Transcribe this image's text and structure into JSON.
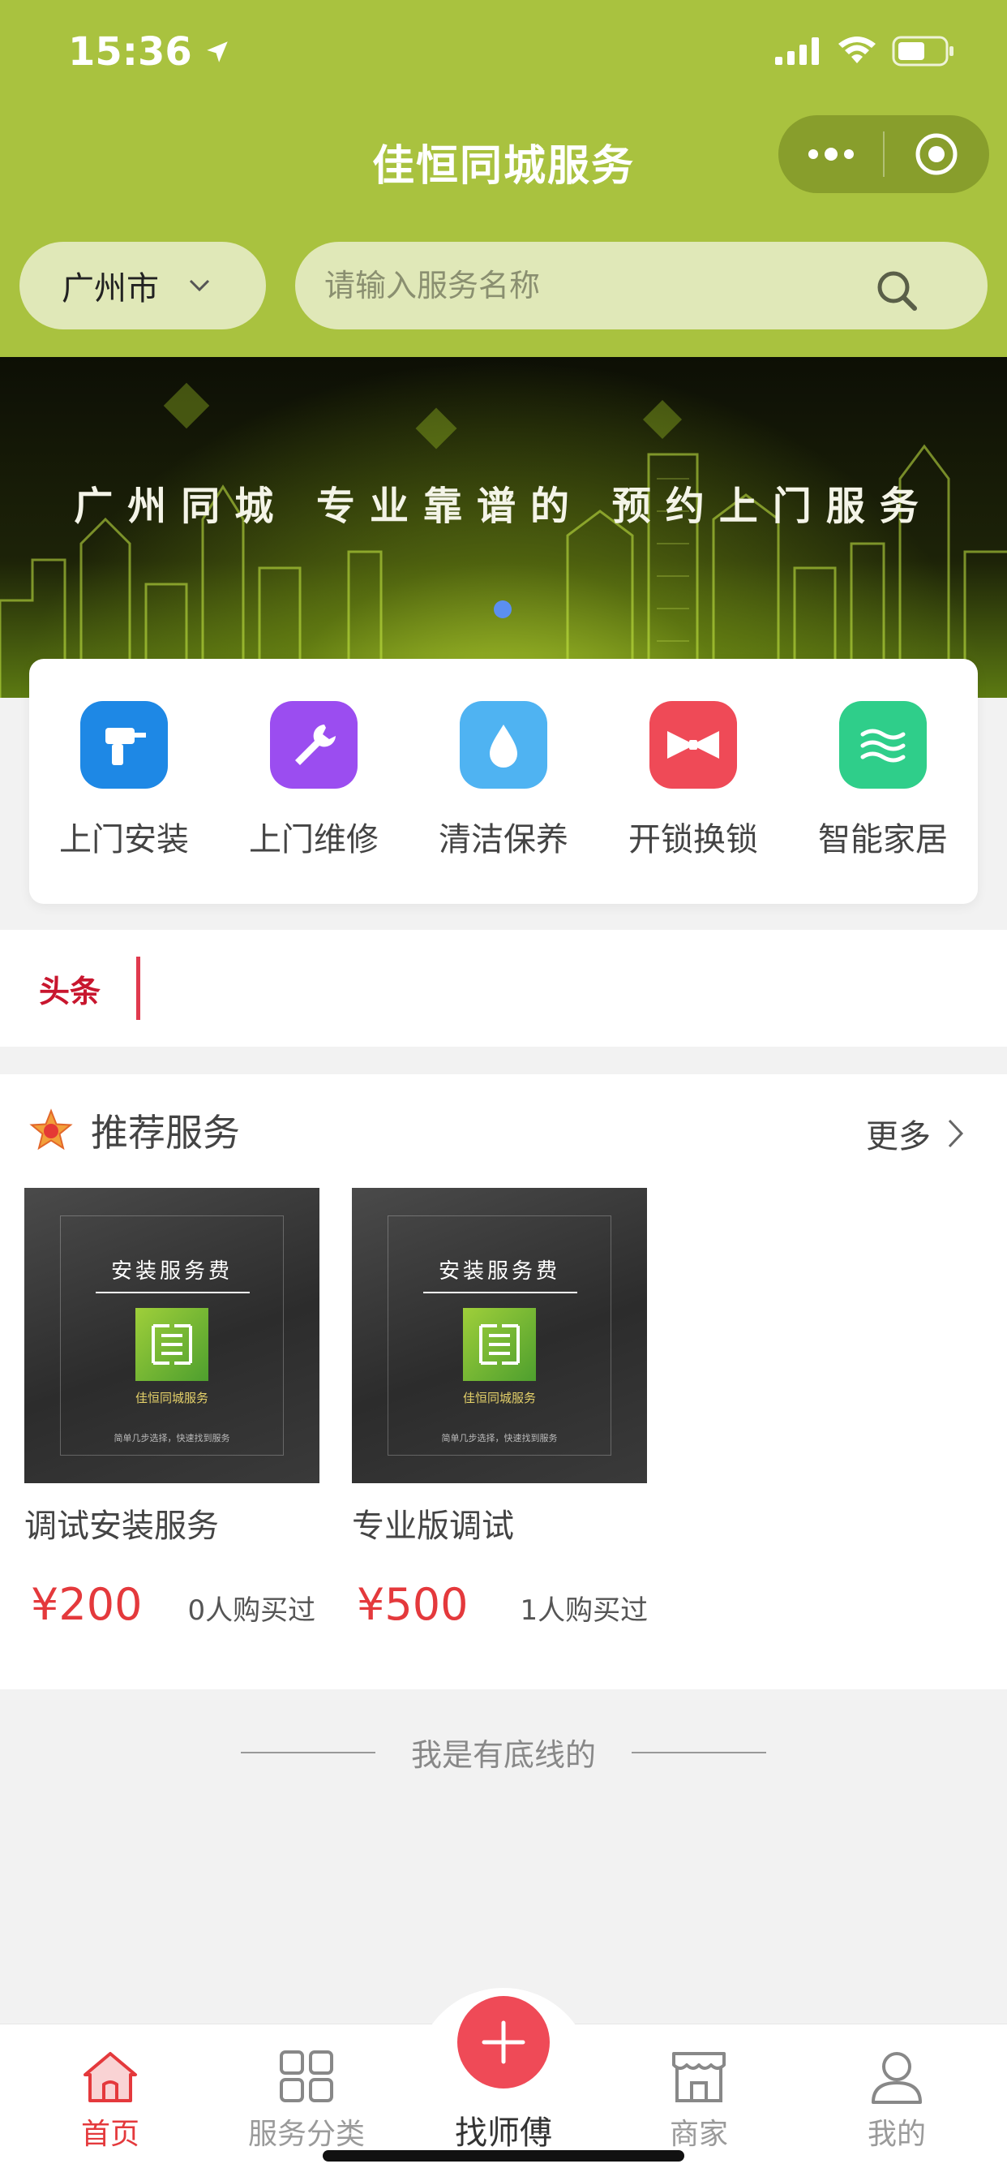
{
  "status_bar": {
    "time": "15:36"
  },
  "header": {
    "title": "佳恒同城服务"
  },
  "location": {
    "city": "广州市"
  },
  "search": {
    "placeholder": "请输入服务名称"
  },
  "banner": {
    "slogan": "广州同城 专业靠谱的 预约上门服务"
  },
  "categories": [
    {
      "label": "上门安装",
      "icon": "drill-icon",
      "color": "#1e88e5"
    },
    {
      "label": "上门维修",
      "icon": "wrench-icon",
      "color": "#9b4df0"
    },
    {
      "label": "清洁保养",
      "icon": "water-drop-icon",
      "color": "#4fb3f2"
    },
    {
      "label": "开锁换锁",
      "icon": "bow-icon",
      "color": "#ef4a57"
    },
    {
      "label": "智能家居",
      "icon": "waves-icon",
      "color": "#2fce8a"
    }
  ],
  "headline": {
    "tag": "头条"
  },
  "recommended": {
    "title": "推荐服务",
    "more": "更多",
    "items": [
      {
        "image_title": "安装服务费",
        "image_brand": "佳恒同城服务",
        "image_slogan": "简单几步选择，快速找到服务",
        "name": "调试安装服务",
        "price": "¥200",
        "sold": "0人购买过"
      },
      {
        "image_title": "安装服务费",
        "image_brand": "佳恒同城服务",
        "image_slogan": "简单几步选择，快速找到服务",
        "name": "专业版调试",
        "price": "¥500",
        "sold": "1人购买过"
      }
    ]
  },
  "footer_note": "我是有底线的",
  "tabbar": {
    "home": "首页",
    "category": "服务分类",
    "find_master": "找师傅",
    "merchant": "商家",
    "mine": "我的"
  },
  "colors": {
    "header": "#a9c23f",
    "accent": "#e4393c",
    "fab": "#ef4a57"
  }
}
